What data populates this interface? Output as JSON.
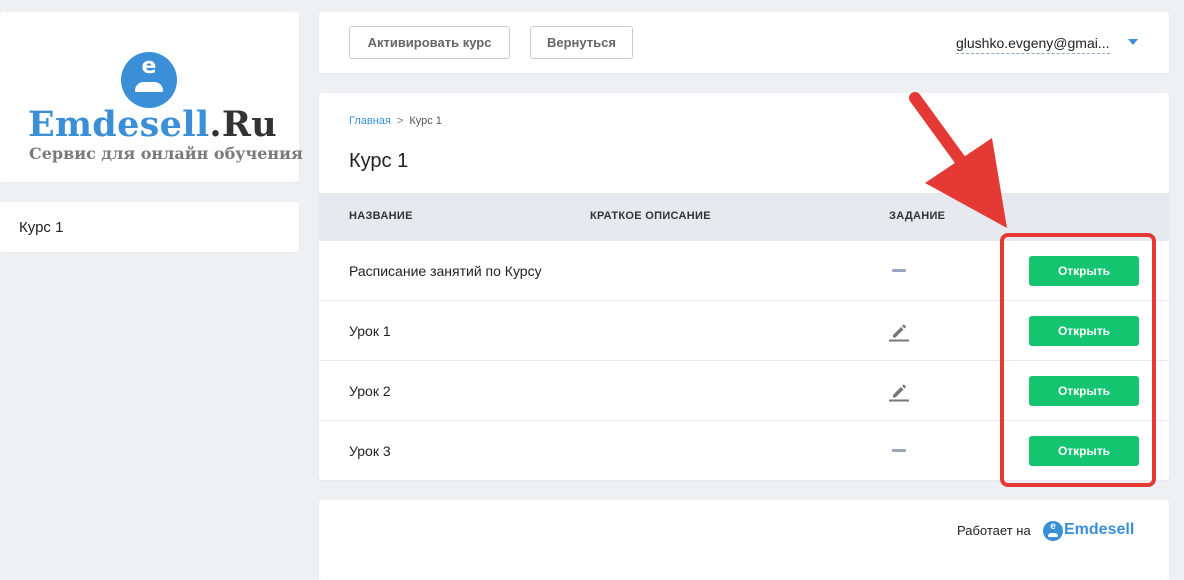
{
  "sidebar": {
    "logo": {
      "letter": "e",
      "title_main": "Emdesell",
      "title_suffix": ".Ru",
      "subtitle": "Сервис для онлайн обучения"
    },
    "items": [
      {
        "label": "Курс 1"
      }
    ]
  },
  "header": {
    "activate_label": "Активировать курс",
    "back_label": "Вернуться",
    "user_email": "glushko.evgeny@gmai..."
  },
  "main": {
    "breadcrumb": {
      "home": "Главная",
      "separator": ">",
      "current": "Курс 1"
    },
    "title": "Курс 1",
    "table": {
      "columns": [
        "НАЗВАНИЕ",
        "КРАТКОЕ ОПИСАНИЕ",
        "ЗАДАНИЕ"
      ],
      "rows": [
        {
          "name": "Расписание занятий по Курсу",
          "description": "",
          "task": "none",
          "action": "Открыть"
        },
        {
          "name": "Урок 1",
          "description": "",
          "task": "edit",
          "action": "Открыть"
        },
        {
          "name": "Урок 2",
          "description": "",
          "task": "edit",
          "action": "Открыть"
        },
        {
          "name": "Урок 3",
          "description": "",
          "task": "none",
          "action": "Открыть"
        }
      ]
    }
  },
  "footer": {
    "powered_by": "Работает на",
    "brand": "Emdesell",
    "brand_letter": "e"
  },
  "icons": {
    "task_none": "dash-icon",
    "task_edit": "pencil-icon",
    "user_menu": "chevron-down-icon"
  },
  "colors": {
    "brand_blue": "#3a8fd6",
    "open_button_green": "#14c46e",
    "annotation_red": "#e53935",
    "table_header_bg": "#e6e9ee"
  }
}
